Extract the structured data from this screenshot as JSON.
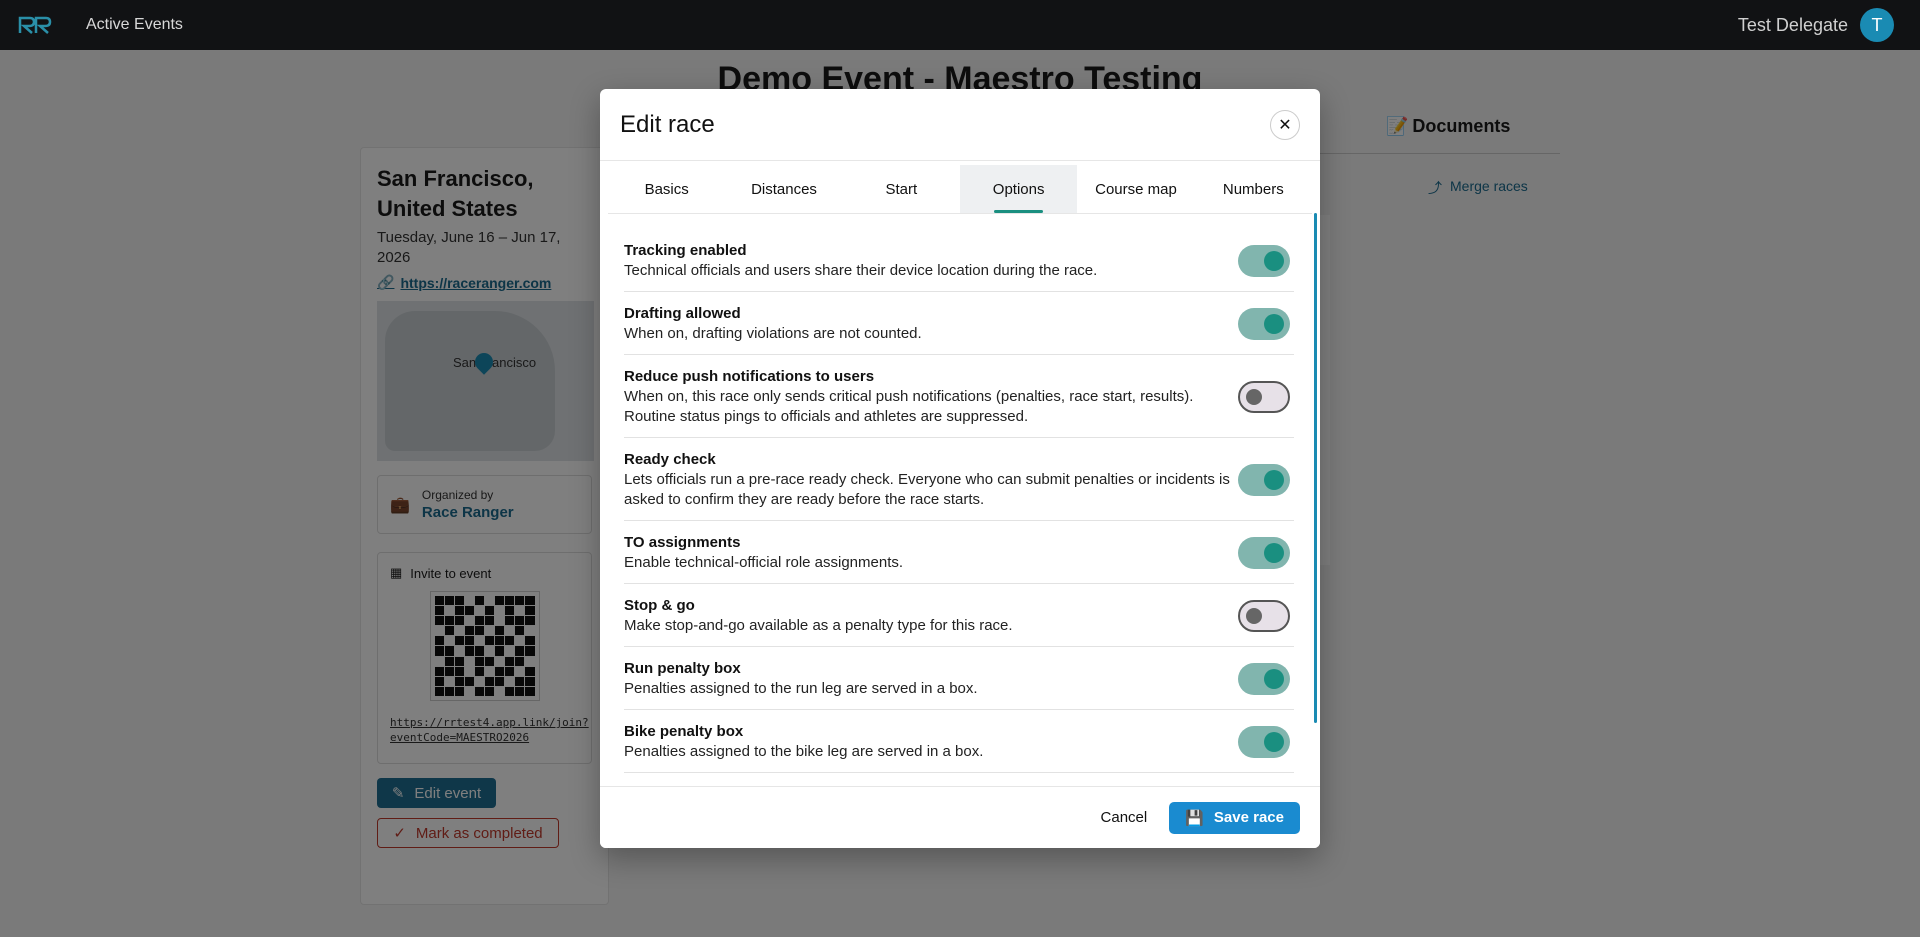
{
  "nav": {
    "active_events": "Active Events",
    "user_name": "Test Delegate",
    "avatar_initial": "T"
  },
  "event": {
    "title": "Demo Event - Maestro Testing",
    "city": "San Francisco, United States",
    "dates": "Tuesday, June 16 – Jun 17, 2026",
    "website": "https://raceranger.com",
    "map_label": "San Francisco",
    "organized_by_label": "Organized by",
    "organizer": "Race Ranger",
    "invite_label": "Invite to event",
    "invite_link": "https://rrtest4.app.link/join?eventCode=MAESTRO2026",
    "edit_event": "Edit event",
    "mark_completed": "Mark as completed",
    "documents_tab": "Documents",
    "merge_races": "Merge races"
  },
  "modal": {
    "title": "Edit race",
    "tabs": [
      "Basics",
      "Distances",
      "Start",
      "Options",
      "Course map",
      "Numbers"
    ],
    "active_tab": "Options",
    "options": [
      {
        "title": "Tracking enabled",
        "desc": "Technical officials and users share their device location during the race.",
        "on": true
      },
      {
        "title": "Drafting allowed",
        "desc": "When on, drafting violations are not counted.",
        "on": true
      },
      {
        "title": "Reduce push notifications to users",
        "desc": "When on, this race only sends critical push notifications (penalties, race start, results). Routine status pings to officials and athletes are suppressed.",
        "on": false
      },
      {
        "title": "Ready check",
        "desc": "Lets officials run a pre-race ready check. Everyone who can submit penalties or incidents is asked to confirm they are ready before the race starts.",
        "on": true
      },
      {
        "title": "TO assignments",
        "desc": "Enable technical-official role assignments.",
        "on": true
      },
      {
        "title": "Stop & go",
        "desc": "Make stop-and-go available as a penalty type for this race.",
        "on": false
      },
      {
        "title": "Run penalty box",
        "desc": "Penalties assigned to the run leg are served in a box.",
        "on": true
      },
      {
        "title": "Bike penalty box",
        "desc": "Penalties assigned to the bike leg are served in a box.",
        "on": true
      }
    ],
    "cancel": "Cancel",
    "save": "Save race"
  },
  "colors": {
    "accent": "#1a8f80",
    "primary_button": "#1a8bd0",
    "topbar": "#111214"
  }
}
